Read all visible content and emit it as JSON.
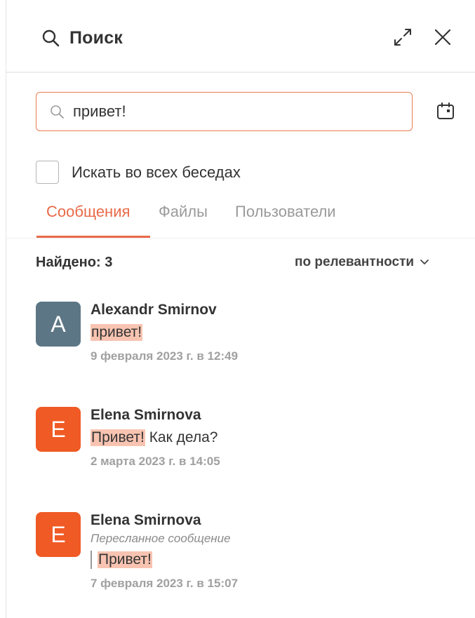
{
  "header": {
    "title": "Поиск",
    "icons": {
      "search": "search-icon",
      "expand": "expand-icon",
      "close": "close-icon"
    }
  },
  "search": {
    "value": "привет!",
    "placeholder": "",
    "icon": "search-icon",
    "calendar_icon": "calendar-icon"
  },
  "filter": {
    "all_chats_label": "Искать во всех беседах",
    "all_chats_checked": false
  },
  "tabs": [
    {
      "label": "Сообщения",
      "active": true
    },
    {
      "label": "Файлы",
      "active": false
    },
    {
      "label": "Пользователи",
      "active": false
    }
  ],
  "results_header": {
    "found": "Найдено: 3",
    "sort": "по релевантности"
  },
  "results": [
    {
      "avatar_letter": "A",
      "avatar_color": "#5d7685",
      "name": "Alexandr Smirnov",
      "highlight": "привет!",
      "rest": "",
      "date": "9 февраля 2023 г. в 12:49"
    },
    {
      "avatar_letter": "E",
      "avatar_color": "#f05a24",
      "name": "Elena Smirnova",
      "highlight": "Привет!",
      "rest": " Как дела?",
      "date": "2 марта 2023 г. в 14:05"
    },
    {
      "avatar_letter": "E",
      "avatar_color": "#f05a24",
      "name": "Elena Smirnova",
      "forwarded": "Пересланное сообщение",
      "highlight": "Привет!",
      "rest": "",
      "date": "7 февраля 2023 г. в 15:07"
    }
  ],
  "colors": {
    "accent": "#e86a48",
    "highlight": "#f8c4b1",
    "search_border": "#e87e56"
  }
}
